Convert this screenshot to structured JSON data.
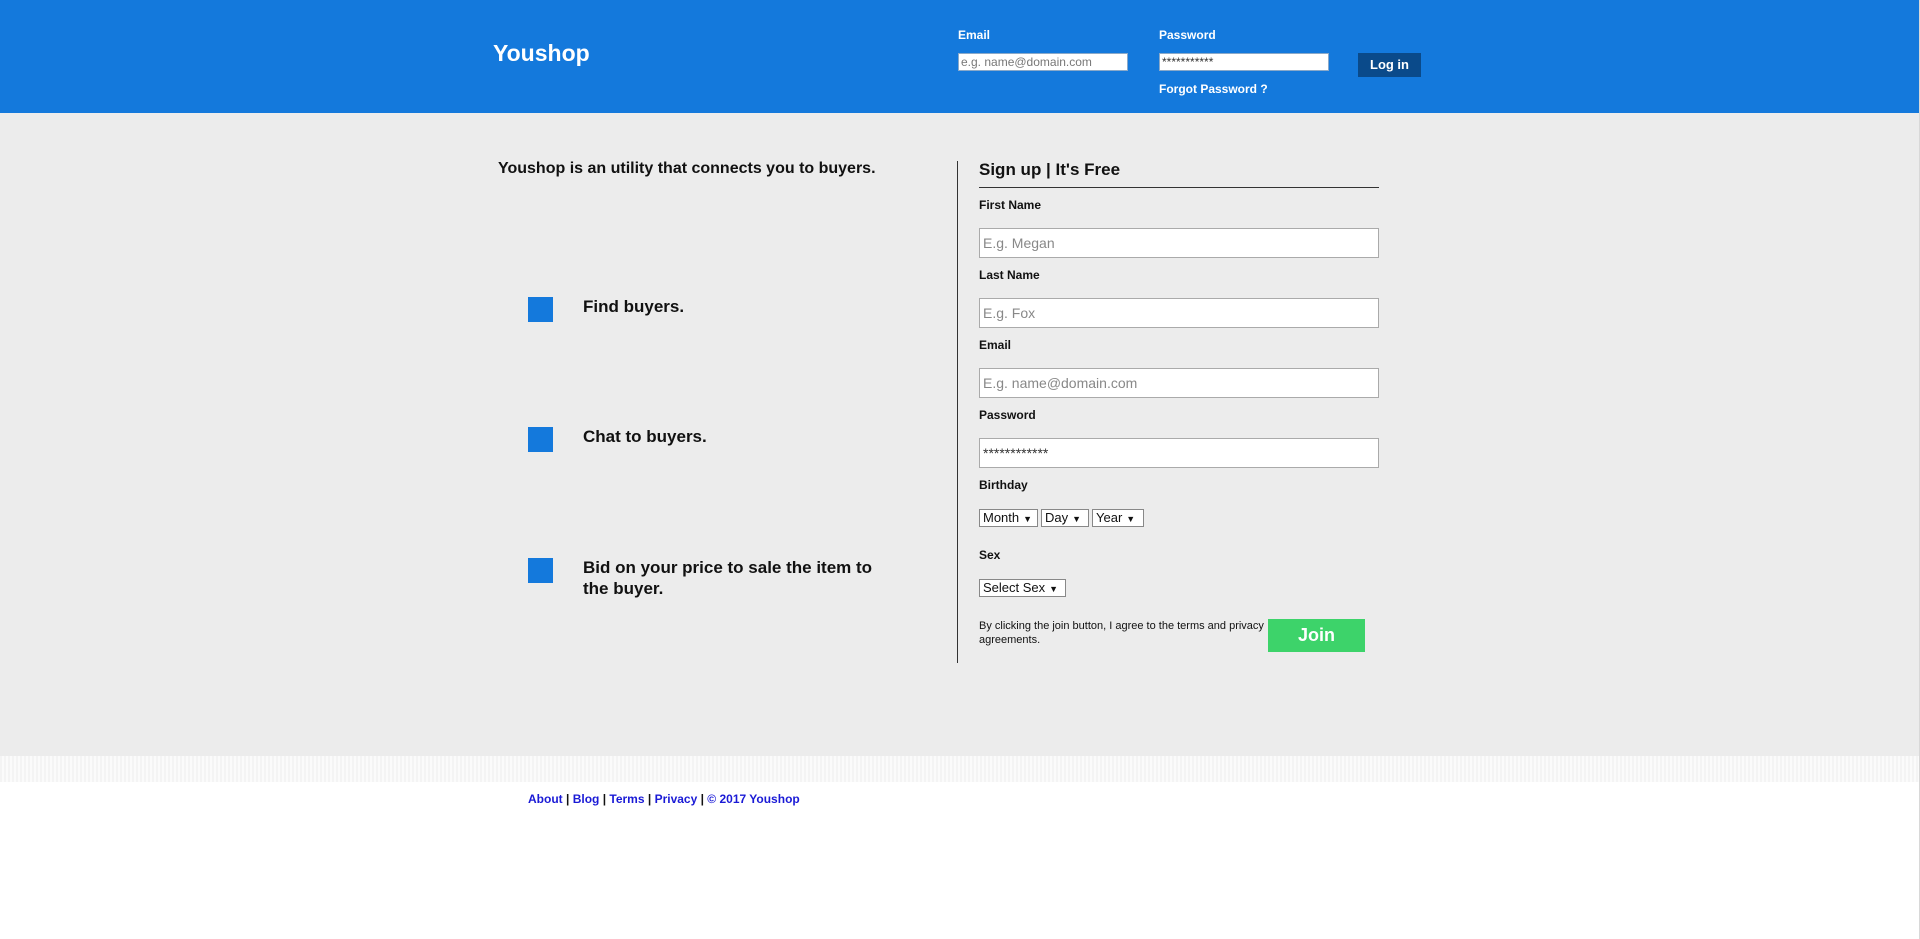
{
  "header": {
    "logo": "Youshop",
    "email_label": "Email",
    "email_placeholder": "e.g. name@domain.com",
    "password_label": "Password",
    "password_value": "***********",
    "login_label": "Log in",
    "forgot_label": "Forgot Password ?"
  },
  "intro": {
    "tagline": "Youshop is an utility that connects you to buyers.",
    "features": [
      "Find buyers.",
      "Chat to buyers.",
      "Bid on your price to sale the item to the buyer."
    ]
  },
  "signup": {
    "title": "Sign up | It's Free",
    "first_name_label": "First Name",
    "first_name_placeholder": "E.g. Megan",
    "last_name_label": "Last Name",
    "last_name_placeholder": "E.g. Fox",
    "email_label": "Email",
    "email_placeholder": "E.g. name@domain.com",
    "password_label": "Password",
    "password_value": "************",
    "birthday_label": "Birthday",
    "month": "Month",
    "day": "Day",
    "year": "Year",
    "sex_label": "Sex",
    "sex": "Select Sex",
    "terms": "By clicking the join button, I agree to the terms and privacy agreements.",
    "join_label": "Join"
  },
  "footer": {
    "about": "About",
    "blog": "Blog",
    "terms": "Terms",
    "privacy": "Privacy",
    "copyright": "© 2017 Youshop",
    "separator": " | "
  },
  "colors": {
    "brand_blue": "#1479dc",
    "login_button": "#0a4a8a",
    "join_button": "#3dd36a",
    "page_bg": "#ececec"
  }
}
